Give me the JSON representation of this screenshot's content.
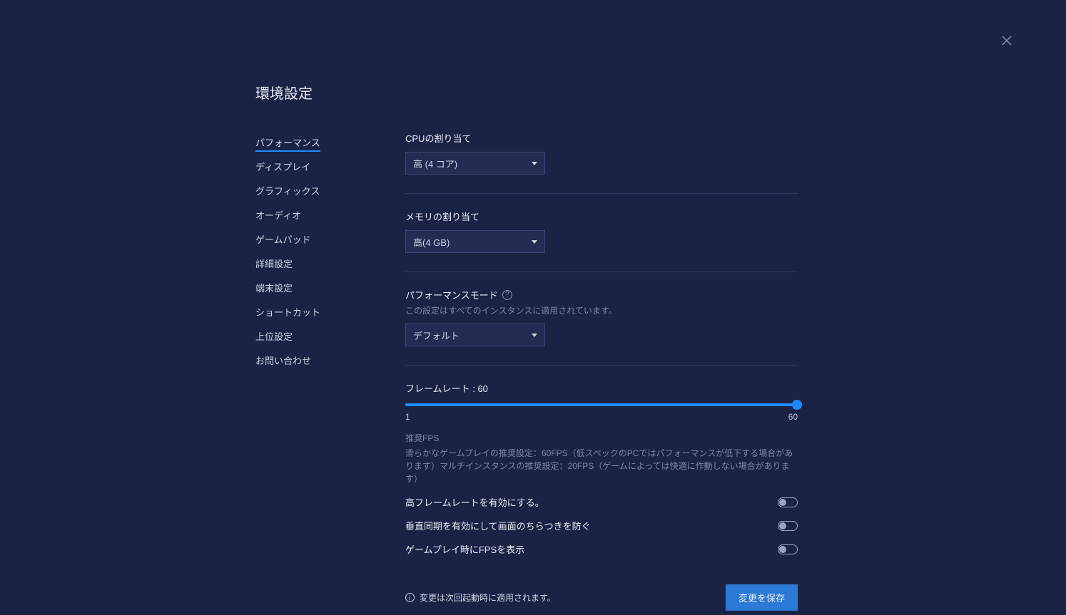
{
  "page_title": "環境設定",
  "close_icon_name": "close-icon",
  "sidebar": {
    "items": [
      {
        "label": "パフォーマンス",
        "active": true
      },
      {
        "label": "ディスプレイ",
        "active": false
      },
      {
        "label": "グラフィックス",
        "active": false
      },
      {
        "label": "オーディオ",
        "active": false
      },
      {
        "label": "ゲームパッド",
        "active": false
      },
      {
        "label": "詳細設定",
        "active": false
      },
      {
        "label": "端末設定",
        "active": false
      },
      {
        "label": "ショートカット",
        "active": false
      },
      {
        "label": "上位設定",
        "active": false
      },
      {
        "label": "お問い合わせ",
        "active": false
      }
    ]
  },
  "cpu": {
    "title": "CPUの割り当て",
    "value": "高 (4 コア)"
  },
  "memory": {
    "title": "メモリの割り当て",
    "value": "高(4 GB)"
  },
  "perf_mode": {
    "title": "パフォーマンスモード",
    "sub": "この設定はすべてのインスタンスに適用されています。",
    "value": "デフォルト",
    "help_glyph": "?"
  },
  "frame_rate": {
    "label_prefix": "フレームレート : ",
    "value": "60",
    "min": "1",
    "max": "60",
    "reco_title": "推奨FPS",
    "reco_text": "滑らかなゲームプレイの推奨設定：60FPS（低スペックのPCではパフォーマンスが低下する場合があります）マルチインスタンスの推奨設定：20FPS（ゲームによっては快適に作動しない場合があります）"
  },
  "toggles": {
    "high_fps": {
      "label": "高フレームレートを有効にする。",
      "on": false
    },
    "vsync": {
      "label": "垂直同期を有効にして画面のちらつきを防ぐ",
      "on": false
    },
    "show_fps": {
      "label": "ゲームプレイ時にFPSを表示",
      "on": false
    }
  },
  "footer": {
    "note": "変更は次回起動時に適用されます。",
    "info_glyph": "i",
    "save_label": "変更を保存"
  }
}
